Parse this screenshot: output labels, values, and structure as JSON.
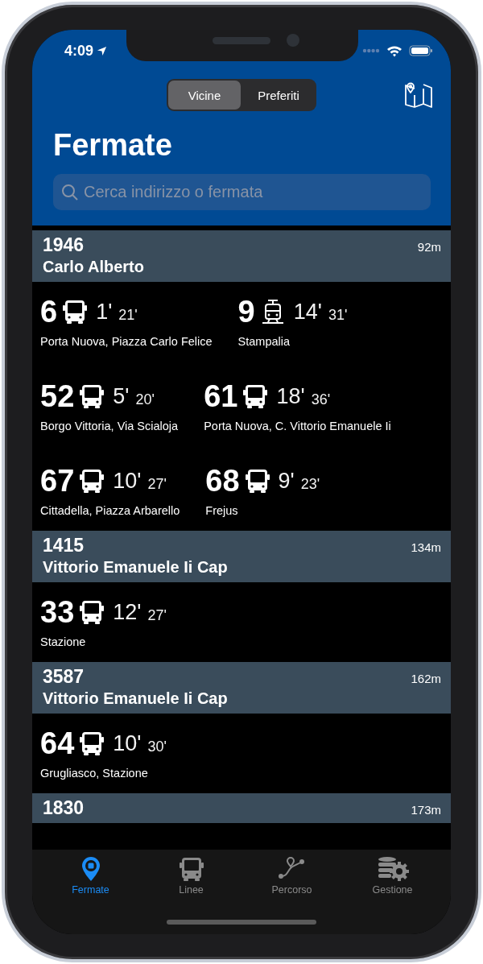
{
  "status_bar": {
    "time": "4:09"
  },
  "header": {
    "segments": [
      {
        "label": "Vicine",
        "selected": true
      },
      {
        "label": "Preferiti",
        "selected": false
      }
    ],
    "title": "Fermate",
    "search": {
      "placeholder": "Cerca indirizzo o fermata"
    }
  },
  "stops": [
    {
      "code": "1946",
      "distance": "92m",
      "name": "Carlo Alberto",
      "departures": [
        {
          "line": "6",
          "kind": "bus",
          "next": "1'",
          "following": "21'",
          "destination": "Porta Nuova, Piazza Carlo Felice"
        },
        {
          "line": "9",
          "kind": "tram",
          "next": "14'",
          "following": "31'",
          "destination": "Stampalia"
        },
        {
          "line": "52",
          "kind": "bus",
          "next": "5'",
          "following": "20'",
          "destination": "Borgo Vittoria, Via Scialoja"
        },
        {
          "line": "61",
          "kind": "bus",
          "next": "18'",
          "following": "36'",
          "destination": "Porta Nuova, C. Vittorio Emanuele Ii"
        },
        {
          "line": "67",
          "kind": "bus",
          "next": "10'",
          "following": "27'",
          "destination": "Cittadella, Piazza Arbarello"
        },
        {
          "line": "68",
          "kind": "bus",
          "next": "9'",
          "following": "23'",
          "destination": "Frejus"
        }
      ]
    },
    {
      "code": "1415",
      "distance": "134m",
      "name": "Vittorio Emanuele Ii Cap",
      "departures": [
        {
          "line": "33",
          "kind": "bus",
          "next": "12'",
          "following": "27'",
          "destination": "Stazione"
        }
      ]
    },
    {
      "code": "3587",
      "distance": "162m",
      "name": "Vittorio Emanuele Ii Cap",
      "departures": [
        {
          "line": "64",
          "kind": "bus",
          "next": "10'",
          "following": "30'",
          "destination": "Grugliasco, Stazione"
        }
      ]
    },
    {
      "code": "1830",
      "distance": "173m"
    }
  ],
  "tab_bar": {
    "items": [
      {
        "label": "Fermate",
        "kind": "stops",
        "selected": true
      },
      {
        "label": "Linee",
        "kind": "lines",
        "selected": false
      },
      {
        "label": "Percorso",
        "kind": "route",
        "selected": false
      },
      {
        "label": "Gestione",
        "kind": "settings",
        "selected": false
      }
    ]
  }
}
